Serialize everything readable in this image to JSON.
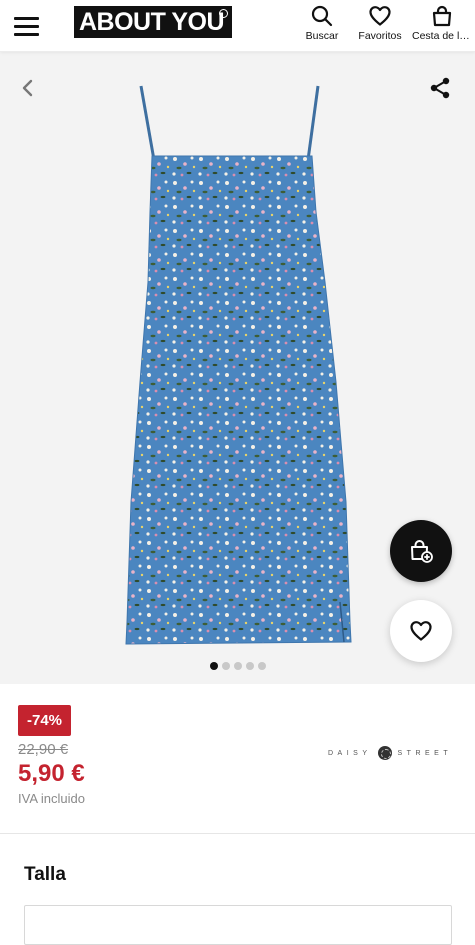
{
  "header": {
    "logo_text": "ABOUT YOU",
    "search_label": "Buscar",
    "favorites_label": "Favoritos",
    "cart_label": "Cesta de la compra"
  },
  "gallery": {
    "image_count": 5,
    "active_index": 0,
    "dress_color": "#4b86c0",
    "background_color": "#f3f3f3"
  },
  "product": {
    "discount_badge": "-74%",
    "old_price": "22,90 €",
    "new_price": "5,90 €",
    "vat_note": "IVA incluido",
    "brand_name": "DAISY STREET"
  },
  "size": {
    "title": "Talla"
  },
  "colors": {
    "accent_red": "#c4232f",
    "text_dark": "#111111",
    "muted_gray": "#8a8a8a"
  },
  "icons": {
    "menu": "hamburger-icon",
    "search": "search-icon",
    "favorites": "heart-icon",
    "cart": "shopping-bag-icon",
    "back": "chevron-left-icon",
    "share": "share-icon",
    "add_to_cart": "bag-plus-icon",
    "add_to_favorites": "heart-icon"
  }
}
